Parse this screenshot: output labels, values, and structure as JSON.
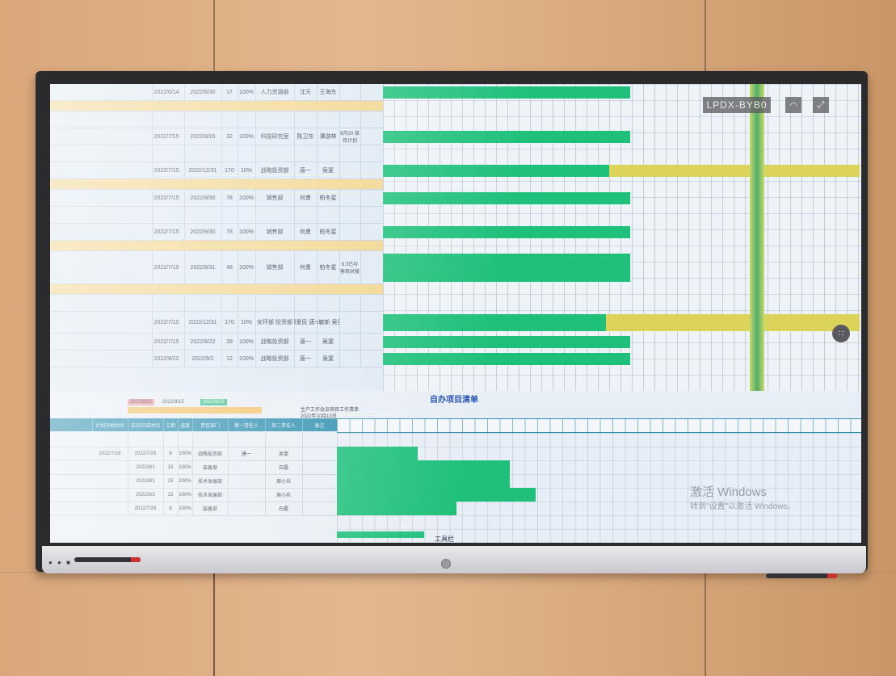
{
  "overlay": {
    "device_id": "LPDX-BYB0",
    "wifi_icon": "wifi-icon",
    "expand_icon": "expand-icon",
    "fab_icon": "grid-menu-icon"
  },
  "upper_rows": [
    {
      "kind": "row",
      "name": "",
      "start": "2022/6/14",
      "end": "2022/6/30",
      "days": "17",
      "pct": "100%",
      "dept": "人力资源部",
      "p1": "沈天",
      "p2": "王海东",
      "note": ""
    },
    {
      "kind": "section",
      "name": ""
    },
    {
      "kind": "row",
      "name": "",
      "start": "",
      "end": "",
      "days": "",
      "pct": "",
      "dept": "",
      "p1": "",
      "p2": "",
      "note": ""
    },
    {
      "kind": "row",
      "name": "",
      "start": "2022/7/15",
      "end": "2022/8/15",
      "days": "32",
      "pct": "100%",
      "dept": "科技研究室",
      "p1": "陈卫东",
      "p2": "谭游林",
      "note": "8月20 接待计划"
    },
    {
      "kind": "row",
      "name": "",
      "start": "",
      "end": "",
      "days": "",
      "pct": "",
      "dept": "",
      "p1": "",
      "p2": "",
      "note": ""
    },
    {
      "kind": "row",
      "name": "",
      "start": "2022/7/15",
      "end": "2022/12/31",
      "days": "170",
      "pct": "10%",
      "dept": "战略投资部",
      "p1": "唐一",
      "p2": "吴斐",
      "note": ""
    },
    {
      "kind": "section",
      "name": ""
    },
    {
      "kind": "row",
      "name": "",
      "start": "2022/7/15",
      "end": "2022/9/30",
      "days": "78",
      "pct": "100%",
      "dept": "销售部",
      "p1": "何勇",
      "p2": "柏冬星",
      "note": ""
    },
    {
      "kind": "row",
      "name": "",
      "start": "",
      "end": "",
      "days": "",
      "pct": "",
      "dept": "",
      "p1": "",
      "p2": "",
      "note": ""
    },
    {
      "kind": "row",
      "name": "",
      "start": "2022/7/15",
      "end": "2022/9/30",
      "days": "78",
      "pct": "100%",
      "dept": "销售部",
      "p1": "何勇",
      "p2": "柏冬星",
      "note": ""
    },
    {
      "kind": "section",
      "name": ""
    },
    {
      "kind": "tall",
      "name": "",
      "start": "2022/7/15",
      "end": "2022/8/31",
      "days": "48",
      "pct": "100%",
      "dept": "销售部",
      "p1": "何勇",
      "p2": "柏冬星",
      "note": "8.3已与客商对接"
    },
    {
      "kind": "section",
      "name": ""
    },
    {
      "kind": "row",
      "name": "",
      "start": "",
      "end": "",
      "days": "",
      "pct": "",
      "dept": "",
      "p1": "",
      "p2": "",
      "note": ""
    },
    {
      "kind": "mid",
      "name": "",
      "start": "2022/7/15",
      "end": "2022/12/31",
      "days": "170",
      "pct": "10%",
      "dept": "安环部 投资部",
      "p1": "顾爱民 唐一",
      "p2": "朱敏新 吴斐",
      "note": ""
    },
    {
      "kind": "row",
      "name": "",
      "start": "2022/7/15",
      "end": "2022/8/22",
      "days": "39",
      "pct": "100%",
      "dept": "战略投资部",
      "p1": "唐一",
      "p2": "吴斐",
      "note": ""
    },
    {
      "kind": "row",
      "name": "",
      "start": "2022/8/22",
      "end": "2022/9/2",
      "days": "12",
      "pct": "100%",
      "dept": "战略投资部",
      "p1": "唐一",
      "p2": "吴斐",
      "note": ""
    }
  ],
  "lower": {
    "title": "自办项目清单",
    "subtitle": "生产工作会议项目工作清单",
    "date_label": "2022年10月13日",
    "chips": [
      "2022/9/23",
      "2022/9/15",
      "2022/9/15"
    ],
    "headers": [
      "计划开始时间",
      "实际完成时间",
      "工期",
      "进度",
      "责任部门",
      "第一责任人",
      "第二责任人",
      "备注"
    ],
    "rows": [
      {
        "start": "",
        "end": "",
        "days": "",
        "pct": "",
        "dept": "",
        "p1": "",
        "p2": ""
      },
      {
        "start": "2022/7/18",
        "end": "2022/7/25",
        "days": "8",
        "pct": "100%",
        "dept": "战略投资部",
        "p1": "唐一",
        "p2": "吴斐"
      },
      {
        "start": "",
        "end": "2022/8/1",
        "days": "15",
        "pct": "100%",
        "dept": "装备部",
        "p1": "",
        "p2": "石磊"
      },
      {
        "start": "",
        "end": "2022/8/1",
        "days": "15",
        "pct": "100%",
        "dept": "技术发展部",
        "p1": "",
        "p2": "周小兵"
      },
      {
        "start": "",
        "end": "2022/8/3",
        "days": "15",
        "pct": "100%",
        "dept": "技术发展部",
        "p1": "",
        "p2": "周小兵"
      },
      {
        "start": "",
        "end": "2022/7/28",
        "days": "8",
        "pct": "100%",
        "dept": "装备部",
        "p1": "",
        "p2": "石磊"
      }
    ],
    "toolbar": "工具栏",
    "windows_line1": "激活 Windows",
    "windows_line2": "转到\"设置\"以激活 Windows。"
  },
  "colors": {
    "bar_green": "#1ec07a",
    "bar_yellow": "#dcd35a",
    "header_teal": "#2f8fb0",
    "title_blue": "#1d4db8",
    "section_tan": "#f2d58c"
  }
}
